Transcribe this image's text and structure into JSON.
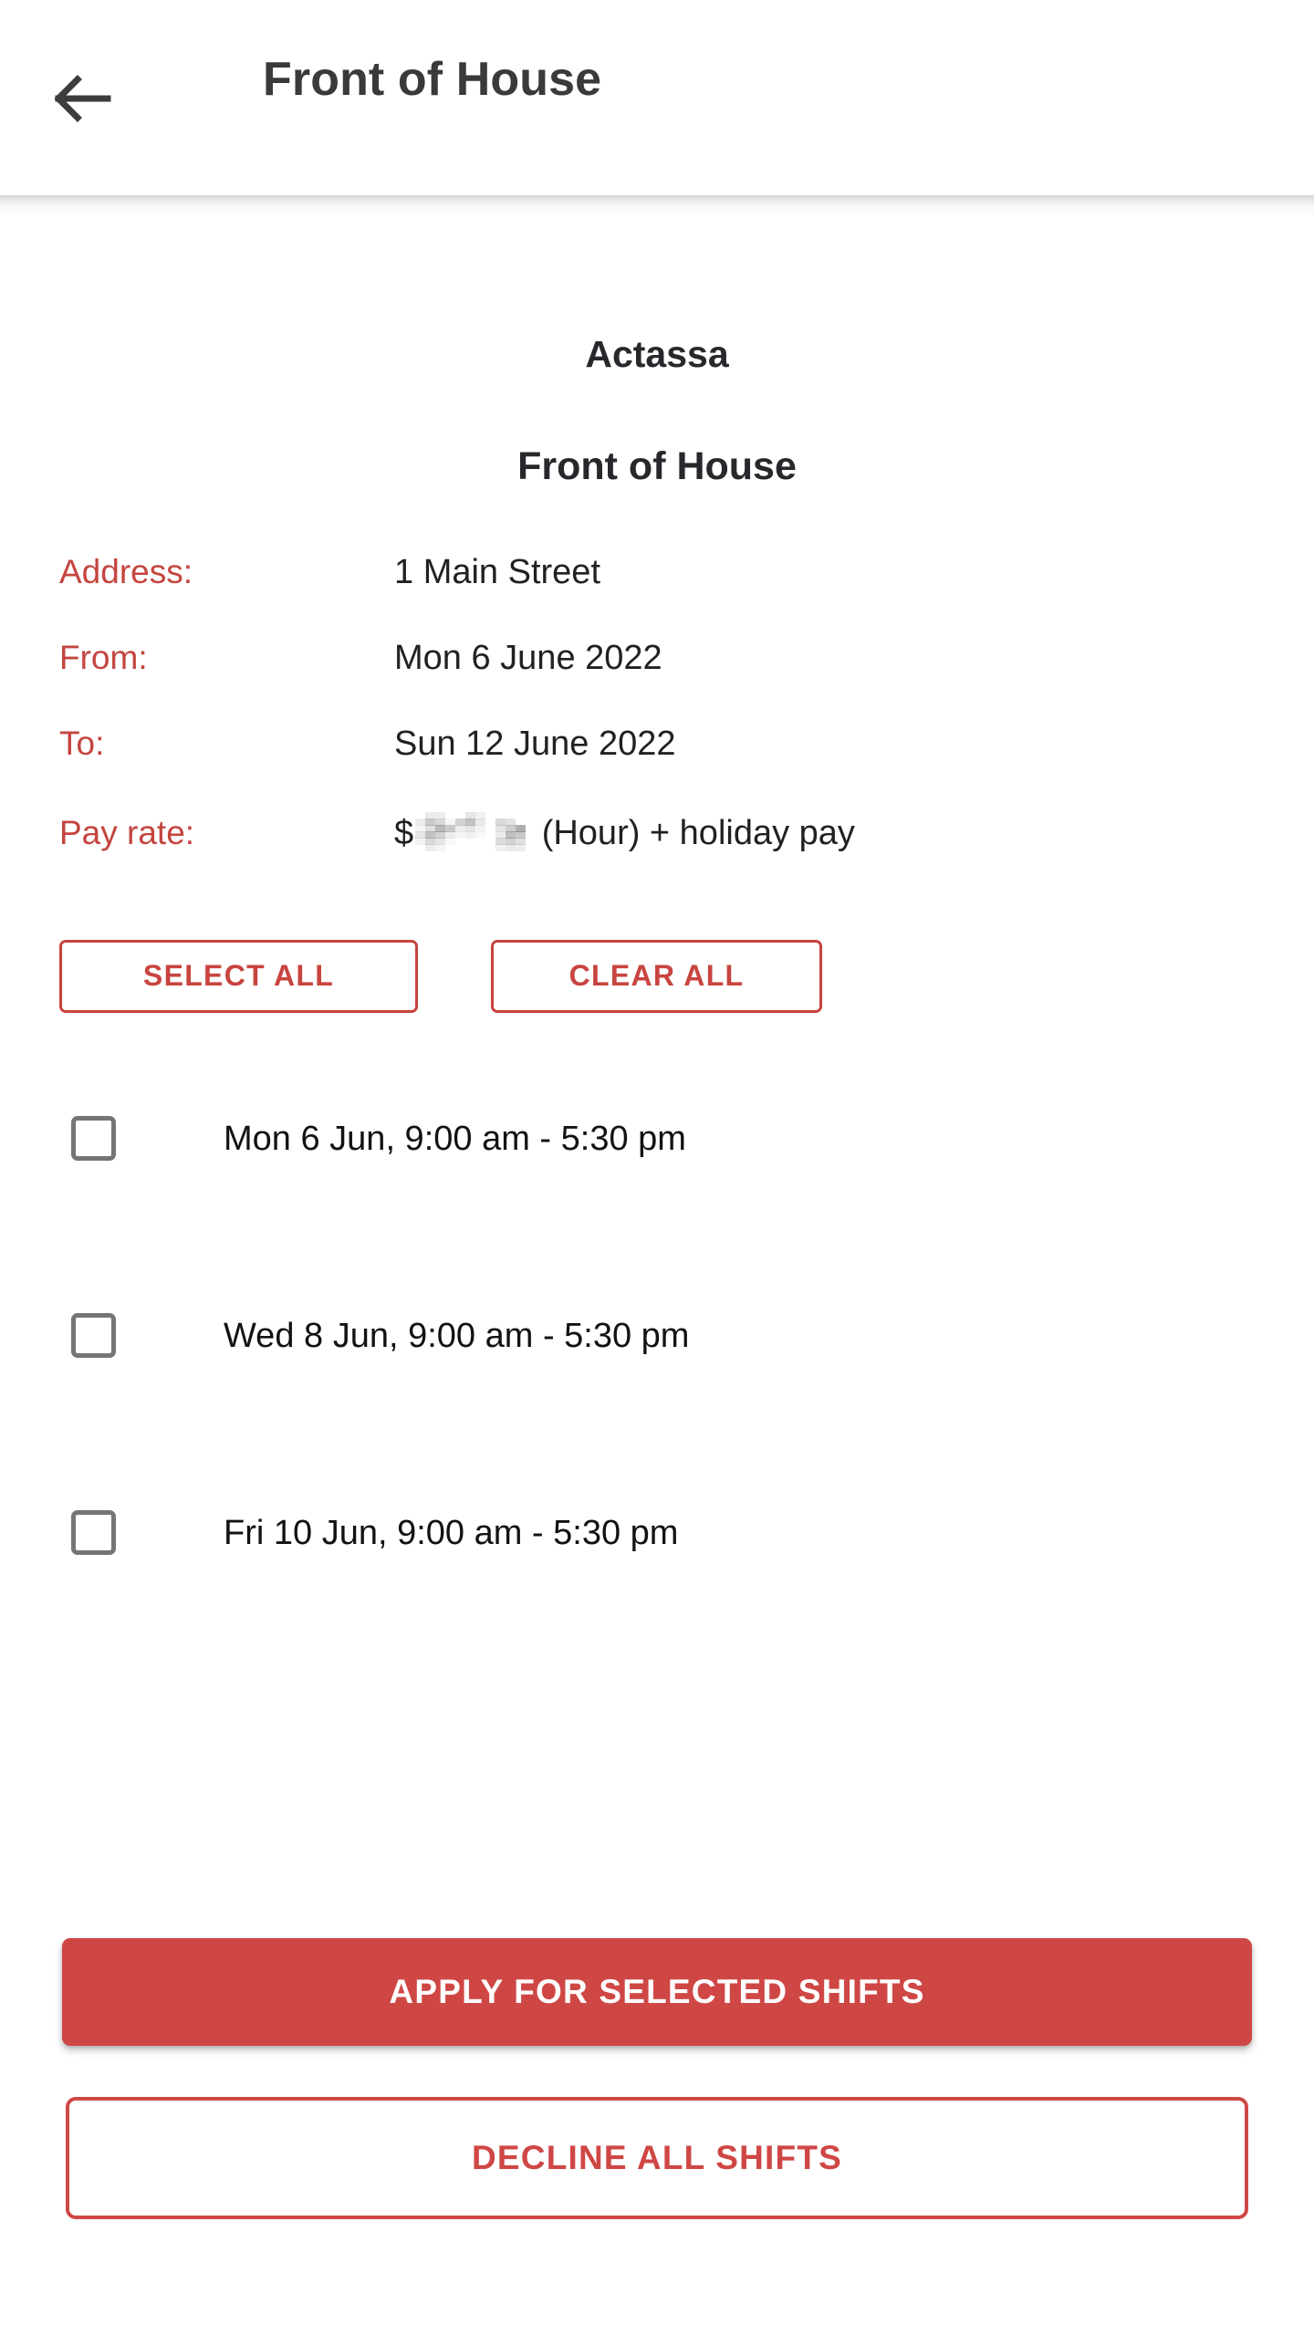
{
  "appbar": {
    "back_icon": "arrow-left-icon",
    "title": "Front of House"
  },
  "header": {
    "organisation": "Actassa",
    "role": "Front of House"
  },
  "details": [
    {
      "label": "Address:",
      "value": "1 Main Street"
    },
    {
      "label": "From:",
      "value": "Mon 6 June 2022"
    },
    {
      "label": "To:",
      "value": "Sun 12 June 2022"
    }
  ],
  "pay_rate": {
    "label": "Pay rate:",
    "currency_symbol": "$",
    "amount": "",
    "amount_redacted": true,
    "suffix": " (Hour) + holiday pay"
  },
  "selection_actions": {
    "select_all_label": "SELECT ALL",
    "clear_all_label": "CLEAR ALL"
  },
  "shifts": [
    {
      "label": "Mon 6 Jun, 9:00 am - 5:30 pm",
      "checked": false
    },
    {
      "label": "Wed 8 Jun, 9:00 am - 5:30 pm",
      "checked": false
    },
    {
      "label": "Fri 10 Jun, 9:00 am - 5:30 pm",
      "checked": false
    }
  ],
  "bottom_actions": {
    "apply_label": "APPLY FOR SELECTED SHIFTS",
    "decline_label": "DECLINE ALL SHIFTS"
  },
  "colors": {
    "accent_red": "#c8443f",
    "button_red": "#cf4745",
    "text_dark": "#1f2124",
    "checkbox_gray": "#757575"
  }
}
